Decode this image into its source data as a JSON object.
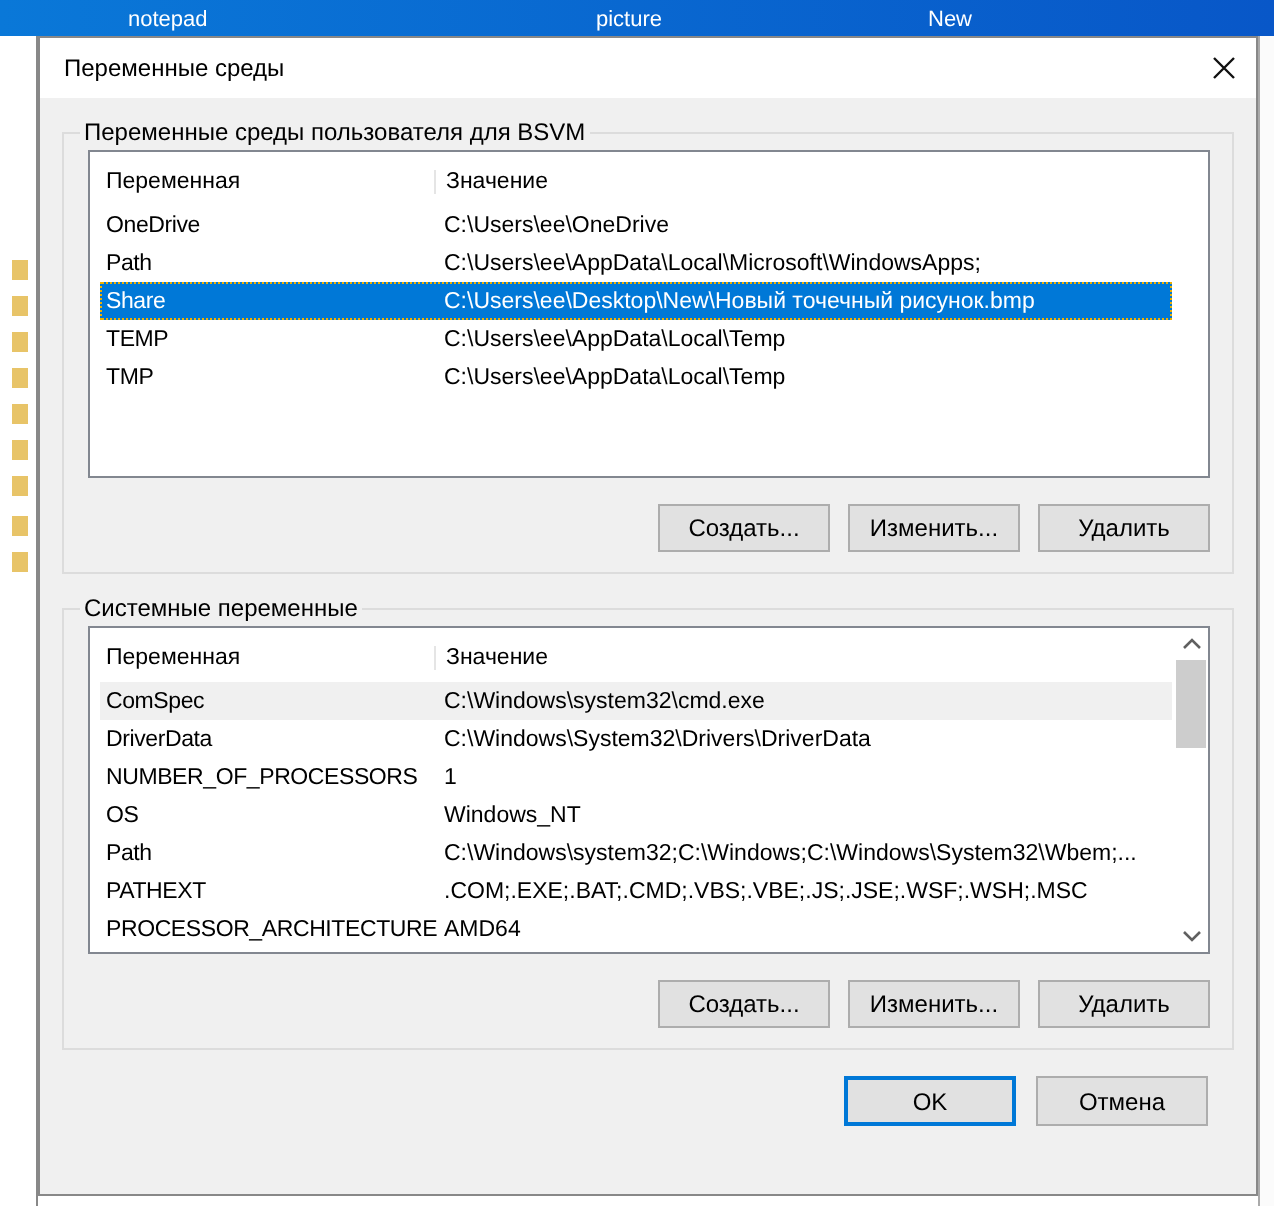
{
  "desktop_icons": [
    {
      "label": "notepad"
    },
    {
      "label": "picture"
    },
    {
      "label": "New"
    }
  ],
  "window": {
    "title": "Переменные среды"
  },
  "user_group": {
    "title": "Переменные среды пользователя для BSVM",
    "focused": true,
    "scrollbar": false,
    "columns": [
      "Переменная",
      "Значение"
    ],
    "rows": [
      {
        "name": "OneDrive",
        "value": "C:\\Users\\ee\\OneDrive",
        "selected": false
      },
      {
        "name": "Path",
        "value": "C:\\Users\\ee\\AppData\\Local\\Microsoft\\WindowsApps;",
        "selected": false
      },
      {
        "name": "Share",
        "value": "C:\\Users\\ee\\Desktop\\New\\Новый точечный рисунок.bmp",
        "selected": true
      },
      {
        "name": "TEMP",
        "value": "C:\\Users\\ee\\AppData\\Local\\Temp",
        "selected": false
      },
      {
        "name": "TMP",
        "value": "C:\\Users\\ee\\AppData\\Local\\Temp",
        "selected": false
      }
    ],
    "buttons": [
      "Создать...",
      "Изменить...",
      "Удалить"
    ]
  },
  "system_group": {
    "title": "Системные переменные",
    "focused": false,
    "scrollbar": true,
    "columns": [
      "Переменная",
      "Значение"
    ],
    "rows": [
      {
        "name": "ComSpec",
        "value": "C:\\Windows\\system32\\cmd.exe",
        "selected": true
      },
      {
        "name": "DriverData",
        "value": "C:\\Windows\\System32\\Drivers\\DriverData",
        "selected": false
      },
      {
        "name": "NUMBER_OF_PROCESSORS",
        "value": "1",
        "selected": false
      },
      {
        "name": "OS",
        "value": "Windows_NT",
        "selected": false
      },
      {
        "name": "Path",
        "value": "C:\\Windows\\system32;C:\\Windows;C:\\Windows\\System32\\Wbem;...",
        "selected": false
      },
      {
        "name": "PATHEXT",
        "value": ".COM;.EXE;.BAT;.CMD;.VBS;.VBE;.JS;.JSE;.WSF;.WSH;.MSC",
        "selected": false
      },
      {
        "name": "PROCESSOR_ARCHITECTURE",
        "value": "AMD64",
        "selected": false
      }
    ],
    "buttons": [
      "Создать...",
      "Изменить...",
      "Удалить"
    ]
  },
  "dialog_buttons": [
    {
      "label": "OK",
      "default": true
    },
    {
      "label": "Отмена",
      "default": false
    }
  ]
}
